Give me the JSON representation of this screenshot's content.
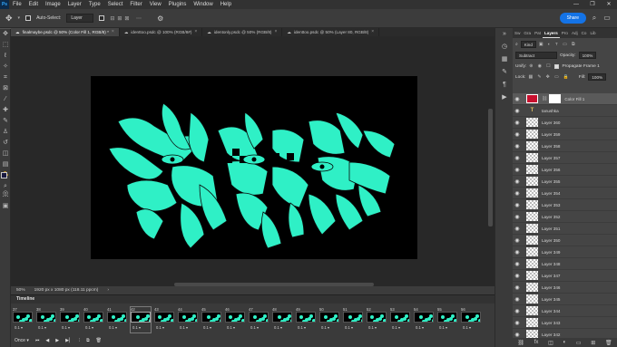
{
  "menubar": {
    "logo": "Ps",
    "items": [
      "File",
      "Edit",
      "Image",
      "Layer",
      "Type",
      "Select",
      "Filter",
      "View",
      "Plugins",
      "Window",
      "Help"
    ],
    "window_controls": [
      "—",
      "❐",
      "✕"
    ]
  },
  "options": {
    "auto_select_label": "Auto-Select:",
    "auto_select_value": "Layer",
    "share_label": "Share"
  },
  "tabs": [
    {
      "label": "finalmaybe.psdc @ 50% (Color Fill 1, RGB/8) *",
      "active": true
    },
    {
      "label": "identtoo.psdc @ 100% (RGB/8#)",
      "active": false
    },
    {
      "label": "identonly.psdc @ 50% (RGB/8)",
      "active": false
    },
    {
      "label": "identtoo.psdc @ 50% (Layer 80, RGB/8)",
      "active": false
    }
  ],
  "status": {
    "zoom": "50%",
    "doc_info": "1920 px x 1080 px (118.11 ppcm)"
  },
  "timeline": {
    "title": "Timeline",
    "frames": [
      {
        "num": "37",
        "delay": "0.1"
      },
      {
        "num": "38",
        "delay": "0.1"
      },
      {
        "num": "39",
        "delay": "0.1"
      },
      {
        "num": "40",
        "delay": "0.1"
      },
      {
        "num": "41",
        "delay": "0.1"
      },
      {
        "num": "42",
        "delay": "0.1",
        "selected": true
      },
      {
        "num": "43",
        "delay": "0.1"
      },
      {
        "num": "44",
        "delay": "0.1"
      },
      {
        "num": "45",
        "delay": "0.1"
      },
      {
        "num": "46",
        "delay": "0.1"
      },
      {
        "num": "47",
        "delay": "0.1"
      },
      {
        "num": "48",
        "delay": "0.1"
      },
      {
        "num": "49",
        "delay": "0.1"
      },
      {
        "num": "50",
        "delay": "0.1"
      },
      {
        "num": "51",
        "delay": "0.1"
      },
      {
        "num": "52",
        "delay": "0.1"
      },
      {
        "num": "53",
        "delay": "0.1"
      },
      {
        "num": "54",
        "delay": "0.1"
      },
      {
        "num": "55",
        "delay": "0.1"
      },
      {
        "num": "56",
        "delay": "0.1"
      }
    ],
    "loop": "Once"
  },
  "layers_panel": {
    "tabs": [
      "Sw",
      "Gra",
      "Pat",
      "Layers",
      "Pro",
      "Adj",
      "Co",
      "Lib"
    ],
    "filter_label": "Kind",
    "blend_mode": "Subtract",
    "opacity_label": "Opacity:",
    "opacity_value": "100%",
    "unify_label": "Unify:",
    "propagate_label": "Propagate Frame 1",
    "lock_label": "Lock:",
    "fill_label": "Fill:",
    "fill_value": "100%",
    "layers": [
      {
        "name": "Color Fill 1",
        "kind": "fill",
        "selected": true
      },
      {
        "name": "tanushka",
        "kind": "text"
      },
      {
        "name": "Layer 360",
        "kind": "pixel"
      },
      {
        "name": "Layer 359",
        "kind": "pixel"
      },
      {
        "name": "Layer 358",
        "kind": "pixel"
      },
      {
        "name": "Layer 357",
        "kind": "pixel"
      },
      {
        "name": "Layer 356",
        "kind": "pixel"
      },
      {
        "name": "Layer 355",
        "kind": "pixel"
      },
      {
        "name": "Layer 354",
        "kind": "pixel"
      },
      {
        "name": "Layer 353",
        "kind": "pixel"
      },
      {
        "name": "Layer 352",
        "kind": "pixel"
      },
      {
        "name": "Layer 351",
        "kind": "pixel"
      },
      {
        "name": "Layer 350",
        "kind": "pixel"
      },
      {
        "name": "Layer 349",
        "kind": "pixel"
      },
      {
        "name": "Layer 348",
        "kind": "pixel"
      },
      {
        "name": "Layer 347",
        "kind": "pixel"
      },
      {
        "name": "Layer 346",
        "kind": "pixel"
      },
      {
        "name": "Layer 345",
        "kind": "pixel"
      },
      {
        "name": "Layer 344",
        "kind": "pixel"
      },
      {
        "name": "Layer 343",
        "kind": "pixel"
      },
      {
        "name": "Layer 342",
        "kind": "pixel"
      }
    ],
    "footer_icons": [
      "link-icon",
      "fx-icon",
      "mask-icon",
      "adjustment-icon",
      "folder-icon",
      "new-layer-icon",
      "trash-icon"
    ]
  },
  "colors": {
    "accent": "#1473e6",
    "artwork": "#2ff0c6",
    "fill_swatch": "#c8102e"
  }
}
